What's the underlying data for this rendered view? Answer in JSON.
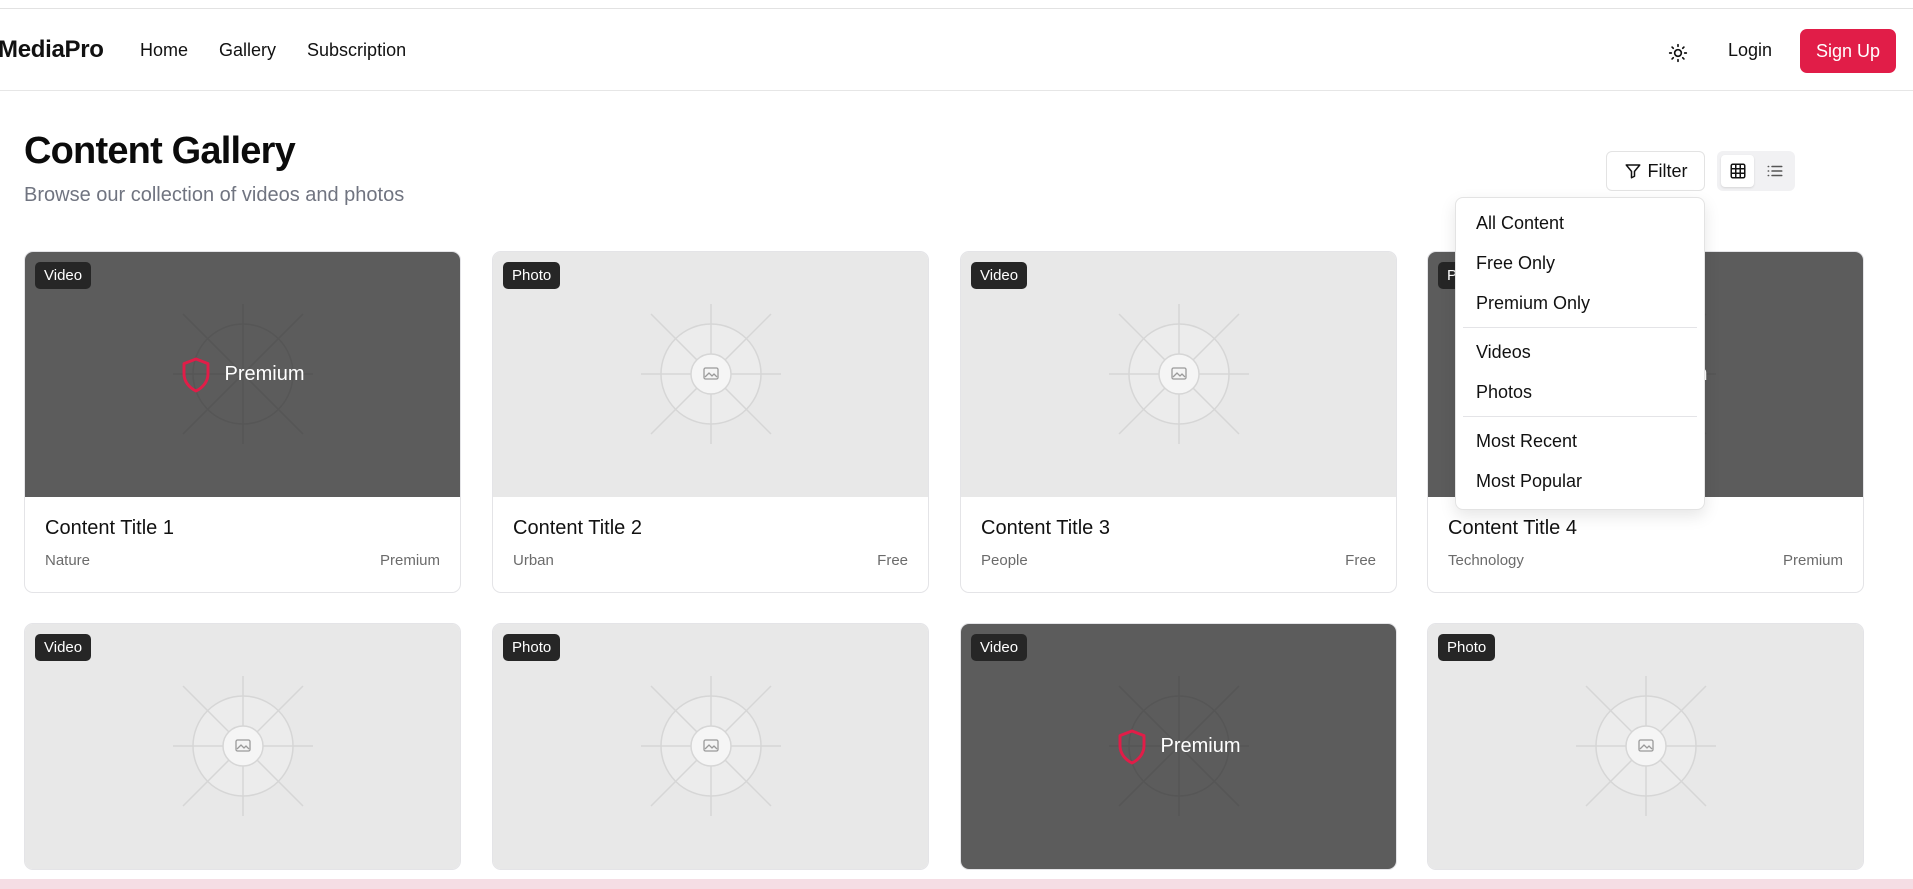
{
  "brand": "MediaPro",
  "nav": {
    "links": [
      "Home",
      "Gallery",
      "Subscription"
    ],
    "login": "Login",
    "signup": "Sign Up",
    "theme_icon": "sun-icon"
  },
  "header": {
    "title": "Content Gallery",
    "subtitle": "Browse our collection of videos and photos"
  },
  "toolbar": {
    "filter_label": "Filter",
    "filter_icon": "funnel-icon",
    "views": [
      "grid-view",
      "list-view"
    ],
    "active_view": "grid-view"
  },
  "filter_menu": {
    "groups": [
      [
        "All Content",
        "Free Only",
        "Premium Only"
      ],
      [
        "Videos",
        "Photos"
      ],
      [
        "Most Recent",
        "Most Popular"
      ]
    ]
  },
  "premium_label": "Premium",
  "cards": [
    {
      "type": "Video",
      "title": "Content Title 1",
      "category": "Nature",
      "tier": "Premium",
      "locked": true
    },
    {
      "type": "Photo",
      "title": "Content Title 2",
      "category": "Urban",
      "tier": "Free",
      "locked": false
    },
    {
      "type": "Video",
      "title": "Content Title 3",
      "category": "People",
      "tier": "Free",
      "locked": false
    },
    {
      "type": "Photo",
      "title": "Content Title 4",
      "category": "Technology",
      "tier": "Premium",
      "locked": true
    },
    {
      "type": "Video",
      "title": "",
      "category": "",
      "tier": "",
      "locked": false
    },
    {
      "type": "Photo",
      "title": "",
      "category": "",
      "tier": "",
      "locked": false
    },
    {
      "type": "Video",
      "title": "",
      "category": "",
      "tier": "",
      "locked": true
    },
    {
      "type": "Photo",
      "title": "",
      "category": "",
      "tier": "",
      "locked": false
    }
  ],
  "colors": {
    "accent": "#e11d48",
    "locked_bg": "#5c5c5c",
    "placeholder_bg": "#e8e8e8",
    "badge_bg": "#262626"
  }
}
